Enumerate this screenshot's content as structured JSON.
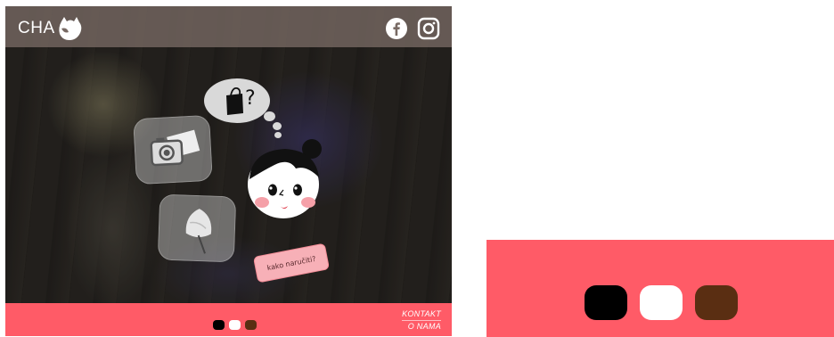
{
  "header": {
    "logo_text": "CHA",
    "logo_icon": "cat-head-icon",
    "social": [
      {
        "name": "facebook-icon"
      },
      {
        "name": "instagram-icon"
      }
    ]
  },
  "hero": {
    "bubble_icon": "shopping-bag-question-icon",
    "tiles": [
      {
        "icon": "camera-photo-icon"
      },
      {
        "icon": "leaf-icon"
      }
    ],
    "character_icon": "girl-face-icon",
    "speech_text": "kako naručiti?"
  },
  "footer": {
    "links": [
      "KONTAKT",
      "O NAMA"
    ],
    "swatches": [
      {
        "name": "black",
        "color": "#000000"
      },
      {
        "name": "white",
        "color": "#ffffff"
      },
      {
        "name": "brown",
        "color": "#5a2e12"
      }
    ]
  },
  "colors": {
    "accent": "#ff5b67",
    "topbar": "#786a64",
    "tag": "#f7b0b7"
  }
}
